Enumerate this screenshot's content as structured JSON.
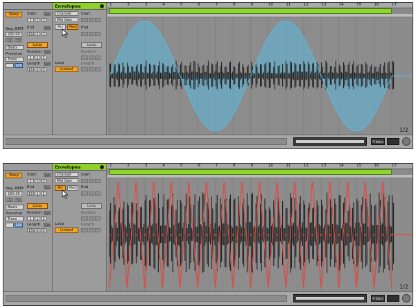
{
  "sample": {
    "header": "",
    "warp_label": "Warp",
    "seg_bpm_label": "Seg. BPM",
    "bpm_value": "160.00",
    "half_label": ":2",
    "double_label": "*2",
    "mode_select": "Beats",
    "preserve_label": "Preserve",
    "preserve_select": "Trans",
    "preserve_extra": "100",
    "start_label": "Start",
    "start_values": [
      "1",
      "1",
      "1"
    ],
    "end_label": "End",
    "end_values": [
      "16",
      "1",
      "1"
    ],
    "loop_label": "Loop",
    "position_label": "Position",
    "position_values": [
      "1",
      "1",
      "1"
    ],
    "length_label": "Length",
    "length_values": [
      "16",
      "0",
      "0"
    ],
    "set_label": "Set"
  },
  "envelopes": {
    "header": "Envelopes",
    "device_select": "Channel",
    "control_select": "Mid Gain",
    "arr_label": "Arr",
    "mod_label": "Mod",
    "loop_label": "Loop",
    "linked_label": "Linked",
    "start_label": "Start",
    "end_label": "End",
    "loop_btn_label": "Loop",
    "position_label": "Position",
    "length_label": "Length"
  },
  "ruler": {
    "ticks": [
      "1",
      "2",
      "3",
      "4",
      "5",
      "6",
      "7",
      "8",
      "9",
      "10",
      "11",
      "12",
      "13",
      "14",
      "15",
      "16",
      "17"
    ]
  },
  "clip_view": {
    "page_counter": "1/2",
    "zoom_label": "4 bars"
  },
  "colors": {
    "loop_green": "#8ed52d",
    "warp_orange": "#f4a323",
    "envelope_blue": "#5bb8dc",
    "envelope_red": "#e8453c"
  },
  "panels": [
    {
      "envelope_color": "#5bb8dc",
      "envelope_type": "sine",
      "envelope_cycles": 2
    },
    {
      "envelope_color": "#e8453c",
      "envelope_type": "triangle",
      "envelope_cycles": 16
    }
  ]
}
